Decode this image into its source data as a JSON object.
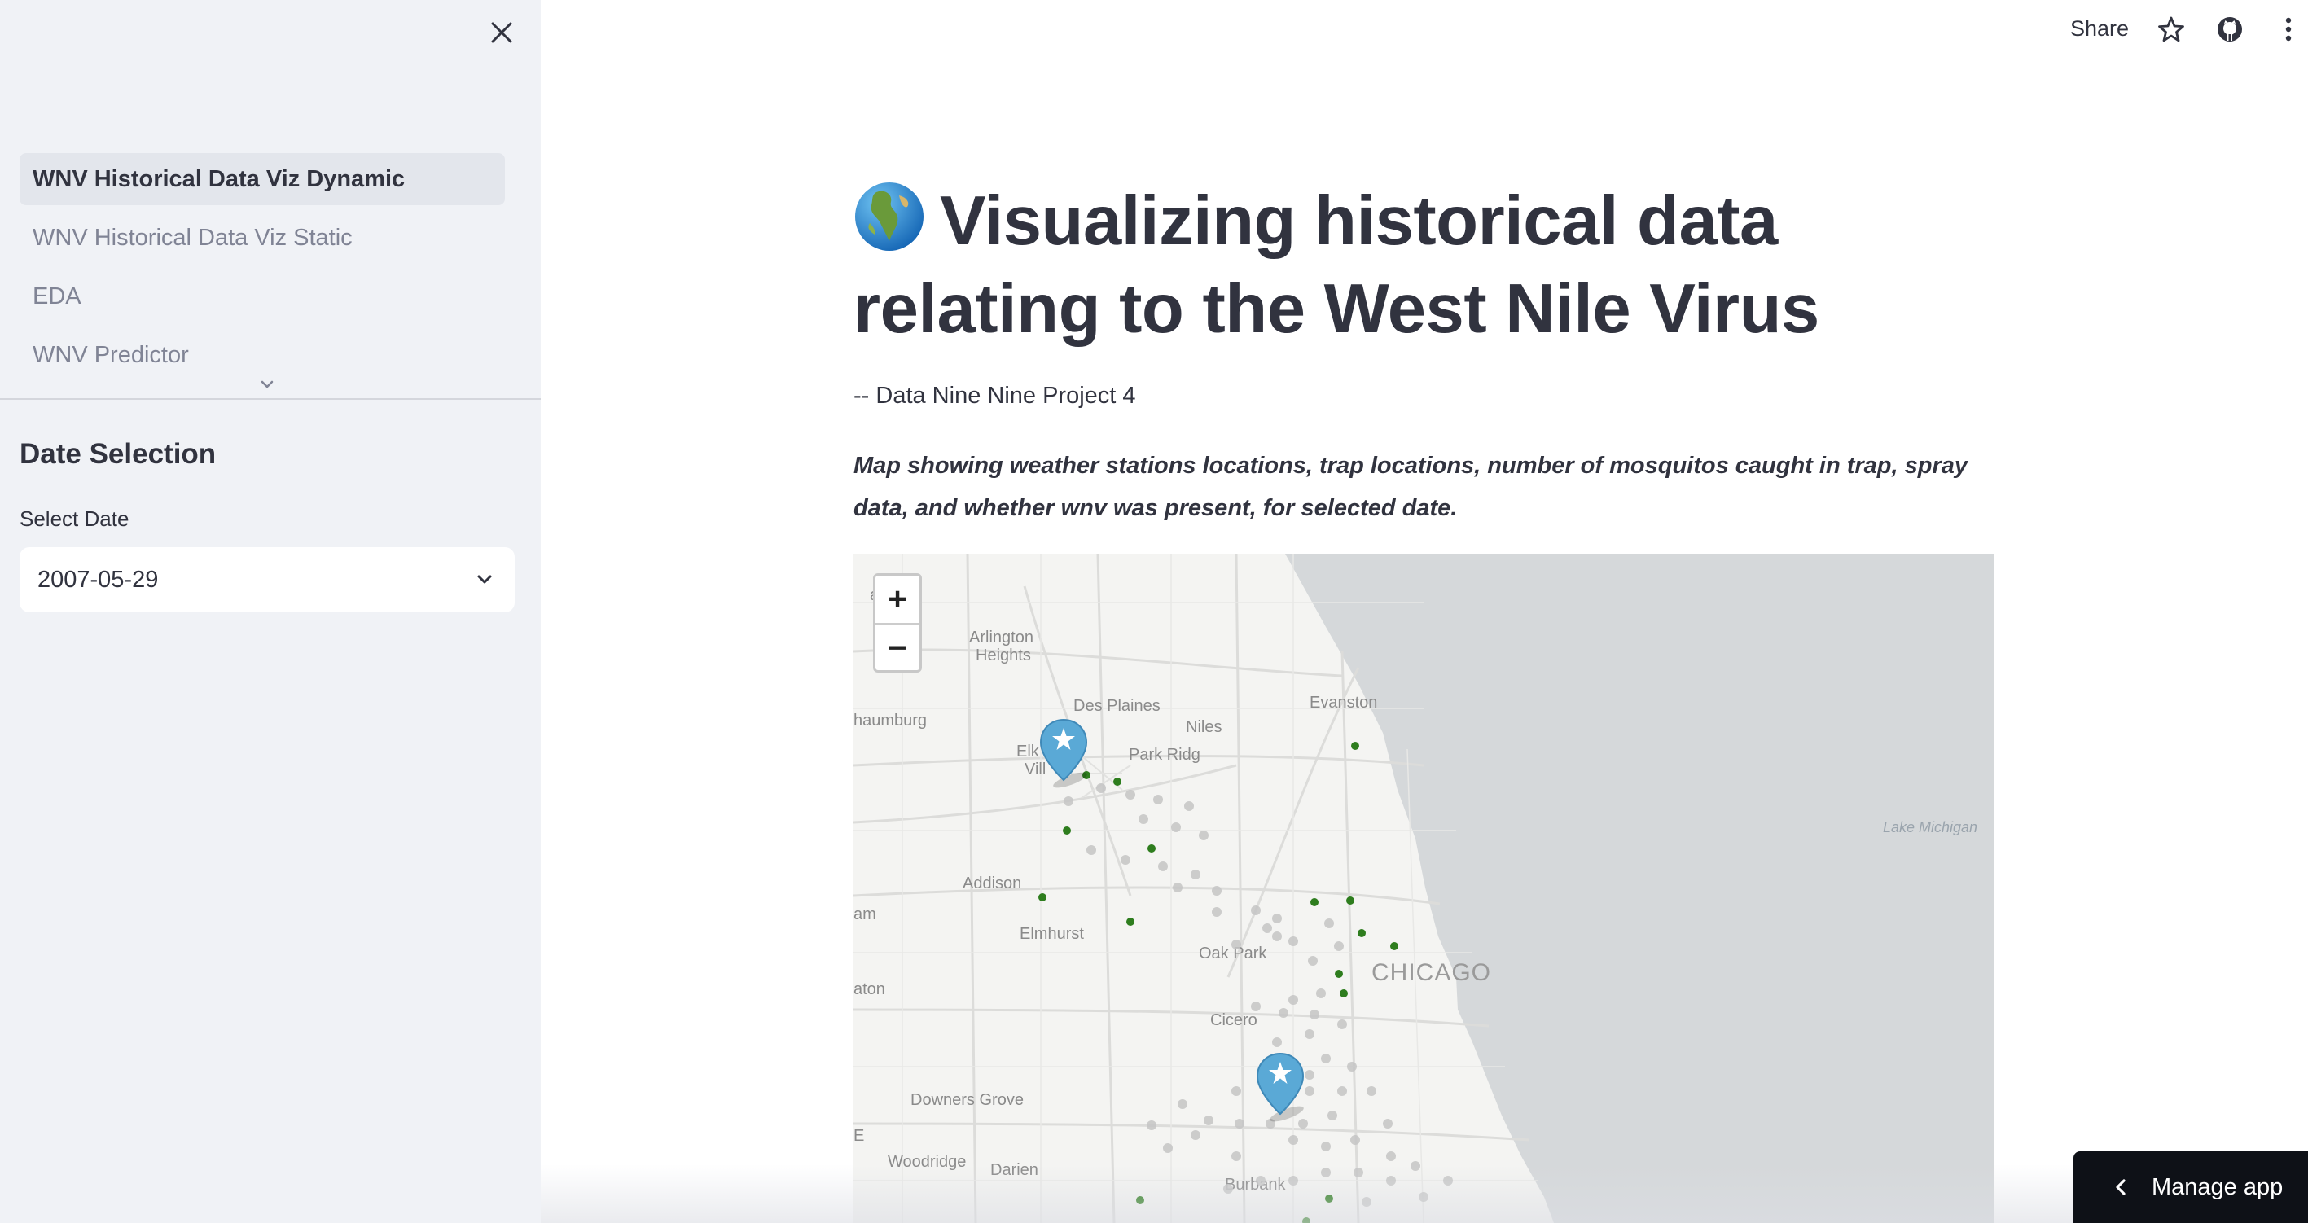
{
  "sidebar": {
    "nav_items": [
      {
        "label": "WNV Historical Data Viz Dynamic",
        "active": true
      },
      {
        "label": "WNV Historical Data Viz Static",
        "active": false
      },
      {
        "label": "EDA",
        "active": false
      },
      {
        "label": "WNV Predictor",
        "active": false
      }
    ],
    "section_heading": "Date Selection",
    "select_label": "Select Date",
    "select_value": "2007-05-29"
  },
  "toolbar": {
    "share_label": "Share",
    "icons": [
      "star-icon",
      "github-icon",
      "more-vert-icon"
    ]
  },
  "main": {
    "title_line1": "Visualizing historical data",
    "title_line2": "relating to the West Nile Virus",
    "subtitle": "-- Data Nine Nine Project 4",
    "caption": "Map showing weather stations locations, trap locations, number of mosquitos caught in trap, spray data, and whether wnv was present, for selected date."
  },
  "map": {
    "zoom_in": "+",
    "zoom_out": "−",
    "labels": {
      "palatine": "alatine",
      "arlington": "Arlington",
      "heights": "Heights",
      "des_plaines": "Des Plaines",
      "evanston": "Evanston",
      "schaumburg": "haumburg",
      "niles": "Niles",
      "park_ridge": "Park Ridg",
      "elk": "Elk",
      "vill": "Vill",
      "lake_michigan": "Lake Michigan",
      "addison": "Addison",
      "am": "am",
      "elmhurst": "Elmhurst",
      "oak_park": "Oak Park",
      "chicago": "CHICAGO",
      "aton": "aton",
      "cicero": "Cicero",
      "downers_grove": "Downers Grove",
      "e": "E",
      "woodridge": "Woodridge",
      "darien": "Darien",
      "burbank": "Burbank"
    },
    "colors": {
      "water": "#d5d8da",
      "land": "#f4f4f2",
      "trap_present": "#2e7d1e",
      "trap_absent": "#c4c4c4",
      "station_marker": "#5aa9d6"
    }
  },
  "manage_app": {
    "label": "Manage app"
  }
}
